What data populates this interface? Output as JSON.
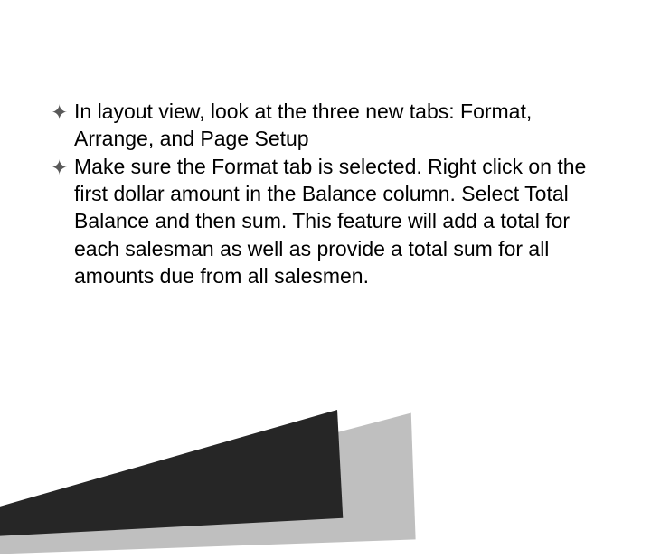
{
  "bullets": [
    {
      "text": "In layout view, look at the three new tabs: Format, Arrange, and Page Setup"
    },
    {
      "text": "Make sure the Format tab is selected.  Right click on the first dollar amount in the Balance column.  Select Total Balance and then sum.  This feature will add a total for each salesman as well as provide a total sum for all amounts due from all salesmen."
    }
  ]
}
